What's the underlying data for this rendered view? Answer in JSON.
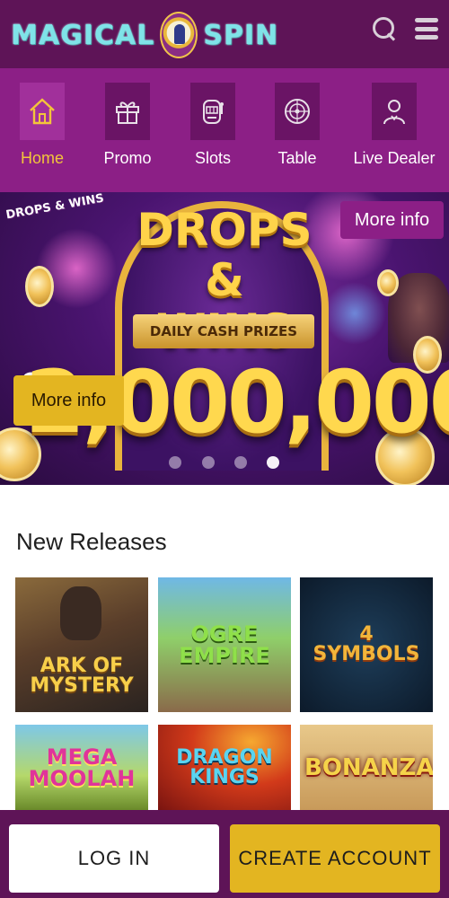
{
  "header": {
    "logo_left": "MAGICAL",
    "logo_right": "SPIN",
    "bg_color": "#5e1457",
    "icons": [
      "search-icon",
      "menu-icon"
    ]
  },
  "nav": {
    "items": [
      {
        "label": "Home",
        "icon": "home-icon",
        "active": true
      },
      {
        "label": "Promo",
        "icon": "gift-icon",
        "active": false
      },
      {
        "label": "Slots",
        "icon": "slot-machine-icon",
        "active": false
      },
      {
        "label": "Table",
        "icon": "roulette-icon",
        "active": false
      },
      {
        "label": "Live Dealer",
        "icon": "dealer-icon",
        "active": false
      }
    ],
    "active_color": "#f3c53a"
  },
  "banner": {
    "badge": "DROPS & WINS",
    "title_line1": "DROPS",
    "title_line2": "& WINS",
    "ribbon": "DAILY CASH PRIZES",
    "currency": "€/£",
    "amount": "2,000,000",
    "more_info_top": "More info",
    "more_info_left": "More info",
    "slides": 4,
    "active_slide": 4
  },
  "new_releases": {
    "title": "New Releases",
    "games": [
      {
        "title": "ARK OF MYSTERY"
      },
      {
        "title": "OGRE EMPIRE"
      },
      {
        "title": "4 SYMBOLS"
      },
      {
        "title": "MEGA MOOLAH"
      },
      {
        "title": "DRAGON KINGS"
      },
      {
        "title": "BONANZA"
      }
    ]
  },
  "footer": {
    "login": "LOG IN",
    "create_account": "CREATE ACCOUNT",
    "accent": "#e3b521"
  }
}
